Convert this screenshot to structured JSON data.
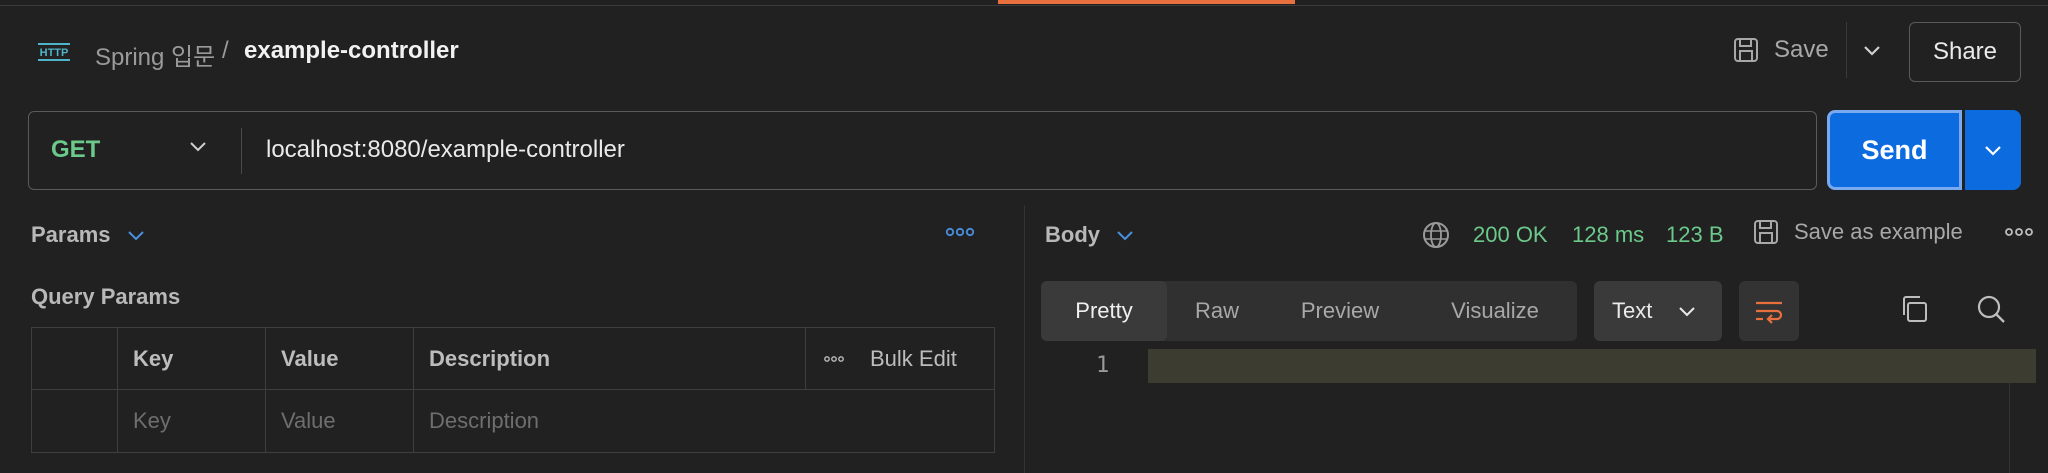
{
  "header": {
    "breadcrumb_parent": "Spring 입문",
    "breadcrumb_separator": "/",
    "request_title": "example-controller",
    "save_label": "Save",
    "share_label": "Share",
    "http_icon_text": "HTTP"
  },
  "request": {
    "method": "GET",
    "url": "localhost:8080/example-controller",
    "send_label": "Send"
  },
  "params_panel": {
    "tab_label": "Params",
    "section_title": "Query Params",
    "columns": [
      "Key",
      "Value",
      "Description"
    ],
    "bulk_edit_label": "Bulk Edit",
    "placeholders": {
      "key": "Key",
      "value": "Value",
      "description": "Description"
    }
  },
  "response": {
    "tab_label": "Body",
    "status": "200 OK",
    "time": "128 ms",
    "size": "123 B",
    "save_example_label": "Save as example",
    "view_tabs": [
      "Pretty",
      "Raw",
      "Preview",
      "Visualize"
    ],
    "active_view": "Pretty",
    "format": "Text",
    "line_numbers": [
      "1"
    ]
  },
  "colors": {
    "accent_blue": "#0d6be0",
    "method_green": "#6bc98a",
    "tab_accent_orange": "#e8703f",
    "background": "#212121"
  }
}
